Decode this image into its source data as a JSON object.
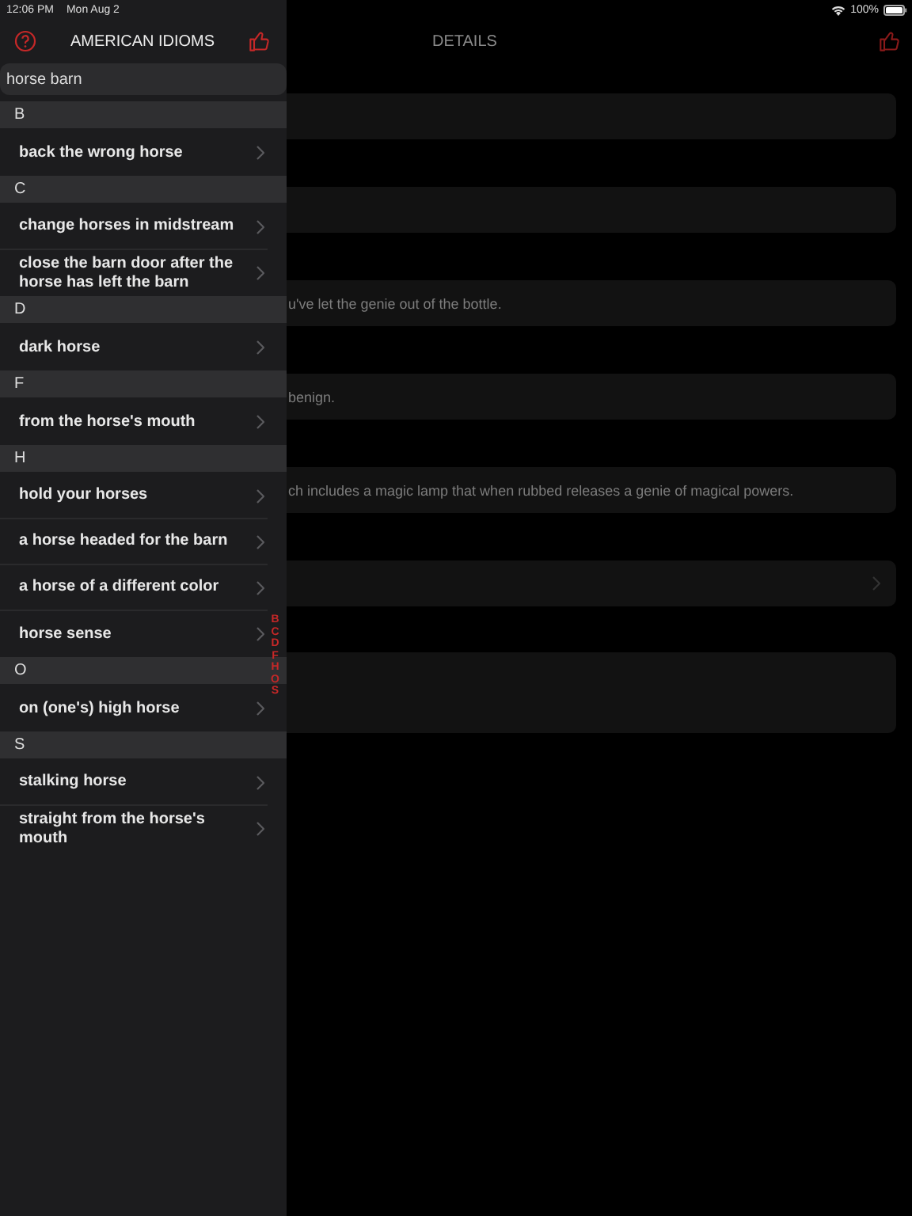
{
  "status_bar": {
    "time": "12:06 PM",
    "date": "Mon Aug 2",
    "battery": "100%"
  },
  "sidebar": {
    "title": "AMERICAN IDIOMS",
    "search": {
      "value": "horse barn"
    },
    "sections": [
      {
        "letter": "B",
        "items": [
          "back the wrong horse"
        ]
      },
      {
        "letter": "C",
        "items": [
          "change horses in midstream",
          "close the barn door after the horse has left the barn"
        ]
      },
      {
        "letter": "D",
        "items": [
          "dark horse"
        ]
      },
      {
        "letter": "F",
        "items": [
          "from the horse's mouth"
        ]
      },
      {
        "letter": "H",
        "items": [
          "hold your horses",
          "a horse headed for the barn",
          "a horse of a different color",
          "horse sense"
        ]
      },
      {
        "letter": "O",
        "items": [
          "on (one's) high horse"
        ]
      },
      {
        "letter": "S",
        "items": [
          "stalking horse",
          "straight from the horse's mouth"
        ]
      }
    ],
    "index": [
      "B",
      "C",
      "D",
      "F",
      "H",
      "O",
      "S"
    ]
  },
  "details": {
    "title": "DETAILS",
    "cards": [
      {
        "kind": "blank"
      },
      {
        "kind": "blank"
      },
      {
        "kind": "text",
        "text": "u've let the genie out of the bottle."
      },
      {
        "kind": "text",
        "text": "benign."
      },
      {
        "kind": "text",
        "text": "ch includes a magic lamp that when rubbed releases a genie of magical powers."
      },
      {
        "kind": "link"
      },
      {
        "kind": "tall"
      }
    ]
  }
}
